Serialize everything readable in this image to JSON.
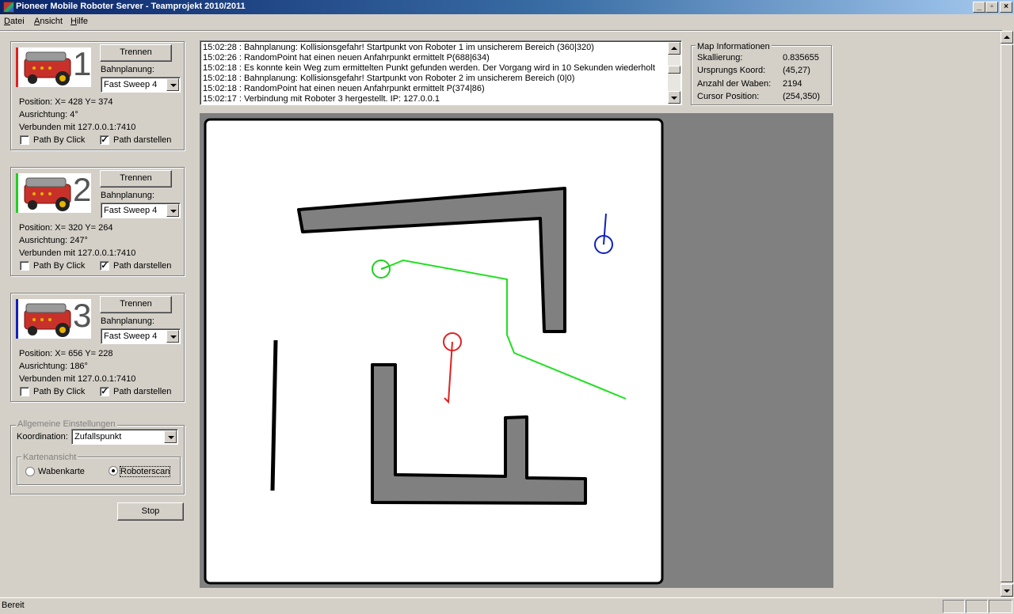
{
  "window": {
    "title": "Pioneer Mobile Roboter Server - Teamprojekt 2010/2011",
    "min_label": "_",
    "max_label": "▫",
    "close_label": "×"
  },
  "menu": [
    "Datei",
    "Ansicht",
    "Hilfe"
  ],
  "robots": [
    {
      "number": "1",
      "color": "#e02020",
      "disconnect_label": "Trennen",
      "planning_label": "Bahnplanung:",
      "planning_value": "Fast Sweep 4",
      "position": "Position: X= 428 Y= 374",
      "orientation": "Ausrichtung: 4°",
      "connection": "Verbunden mit 127.0.0.1:7410",
      "path_by_click_label": "Path By Click",
      "path_by_click_checked": false,
      "show_path_label": "Path darstellen",
      "show_path_checked": true
    },
    {
      "number": "2",
      "color": "#20d020",
      "disconnect_label": "Trennen",
      "planning_label": "Bahnplanung:",
      "planning_value": "Fast Sweep 4",
      "position": "Position: X= 320 Y= 264",
      "orientation": "Ausrichtung: 247°",
      "connection": "Verbunden mit 127.0.0.1:7410",
      "path_by_click_label": "Path By Click",
      "path_by_click_checked": false,
      "show_path_label": "Path darstellen",
      "show_path_checked": true
    },
    {
      "number": "3",
      "color": "#1020c0",
      "disconnect_label": "Trennen",
      "planning_label": "Bahnplanung:",
      "planning_value": "Fast Sweep 4",
      "position": "Position: X= 656 Y= 228",
      "orientation": "Ausrichtung: 186°",
      "connection": "Verbunden mit 127.0.0.1:7410",
      "path_by_click_label": "Path By Click",
      "path_by_click_checked": false,
      "show_path_label": "Path darstellen",
      "show_path_checked": true
    }
  ],
  "general": {
    "title": "Allgemeine Einstellungen",
    "coordination_label": "Koordination:",
    "coordination_value": "Zufallspunkt",
    "map_view_title": "Kartenansicht",
    "option_honeycomb": "Wabenkarte",
    "option_robotscan": "Roboterscan",
    "selected": "Roboterscan"
  },
  "stop_label": "Stop",
  "log": [
    "15:02:28 : Bahnplanung: Kollisionsgefahr! Startpunkt von Roboter 1 im unsicherem Bereich (360|320)",
    "15:02:26 : RandomPoint hat einen neuen Anfahrpunkt ermittelt P(688|634)",
    "15:02:18 : Es konnte kein Weg zum ermittelten Punkt gefunden werden. Der Vorgang wird in 10 Sekunden wiederholt",
    "15:02:18 : Bahnplanung: Kollisionsgefahr! Startpunkt von Roboter 2 im unsicherem Bereich (0|0)",
    "15:02:18 : RandomPoint hat einen neuen Anfahrpunkt ermittelt P(374|86)",
    "15:02:17 : Verbindung mit Roboter 3 hergestellt. IP: 127.0.0.1"
  ],
  "map_info": {
    "title": "Map Informationen",
    "rows": [
      {
        "label": "Skallierung:",
        "value": "0.835655"
      },
      {
        "label": "Ursprungs Koord:",
        "value": "(45,27)"
      },
      {
        "label": "Anzahl der Waben:",
        "value": "2194"
      },
      {
        "label": "Cursor Position:",
        "value": "(254,350)"
      }
    ]
  },
  "status": "Bereit"
}
